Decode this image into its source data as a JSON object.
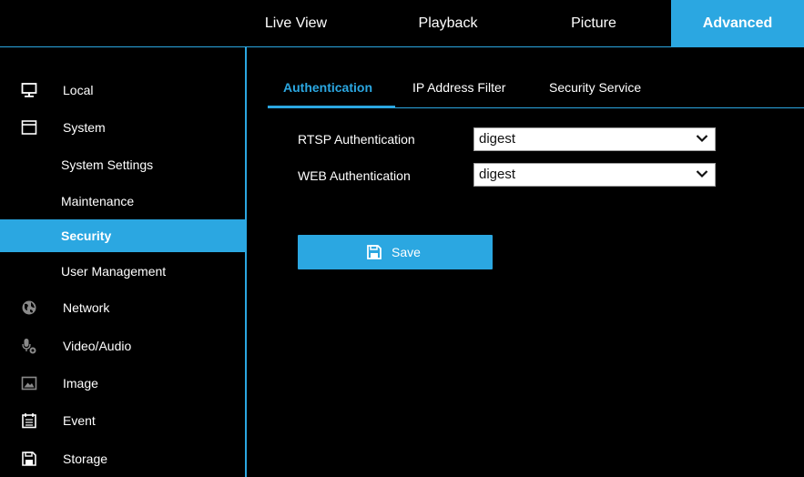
{
  "topnav": {
    "tabs": [
      {
        "label": "Live View"
      },
      {
        "label": "Playback"
      },
      {
        "label": "Picture"
      },
      {
        "label": "Advanced"
      }
    ],
    "active": "Advanced"
  },
  "sidebar": {
    "items": [
      {
        "label": "Local",
        "icon": "monitor-icon"
      },
      {
        "label": "System",
        "icon": "window-icon"
      },
      {
        "label": "System Settings"
      },
      {
        "label": "Maintenance"
      },
      {
        "label": "Security"
      },
      {
        "label": "User Management"
      },
      {
        "label": "Network",
        "icon": "globe-icon"
      },
      {
        "label": "Video/Audio",
        "icon": "microphone-camera-icon"
      },
      {
        "label": "Image",
        "icon": "image-icon"
      },
      {
        "label": "Event",
        "icon": "calendar-icon"
      },
      {
        "label": "Storage",
        "icon": "save-icon"
      }
    ],
    "active": "Security"
  },
  "content": {
    "subtabs": [
      {
        "label": "Authentication"
      },
      {
        "label": "IP Address Filter"
      },
      {
        "label": "Security Service"
      }
    ],
    "active_subtab": "Authentication",
    "form": {
      "rtsp": {
        "label": "RTSP Authentication",
        "value": "digest"
      },
      "web": {
        "label": "WEB Authentication",
        "value": "digest"
      }
    },
    "save_label": "Save"
  },
  "colors": {
    "accent": "#2ba7e1",
    "background": "#000000",
    "text": "#ffffff"
  }
}
